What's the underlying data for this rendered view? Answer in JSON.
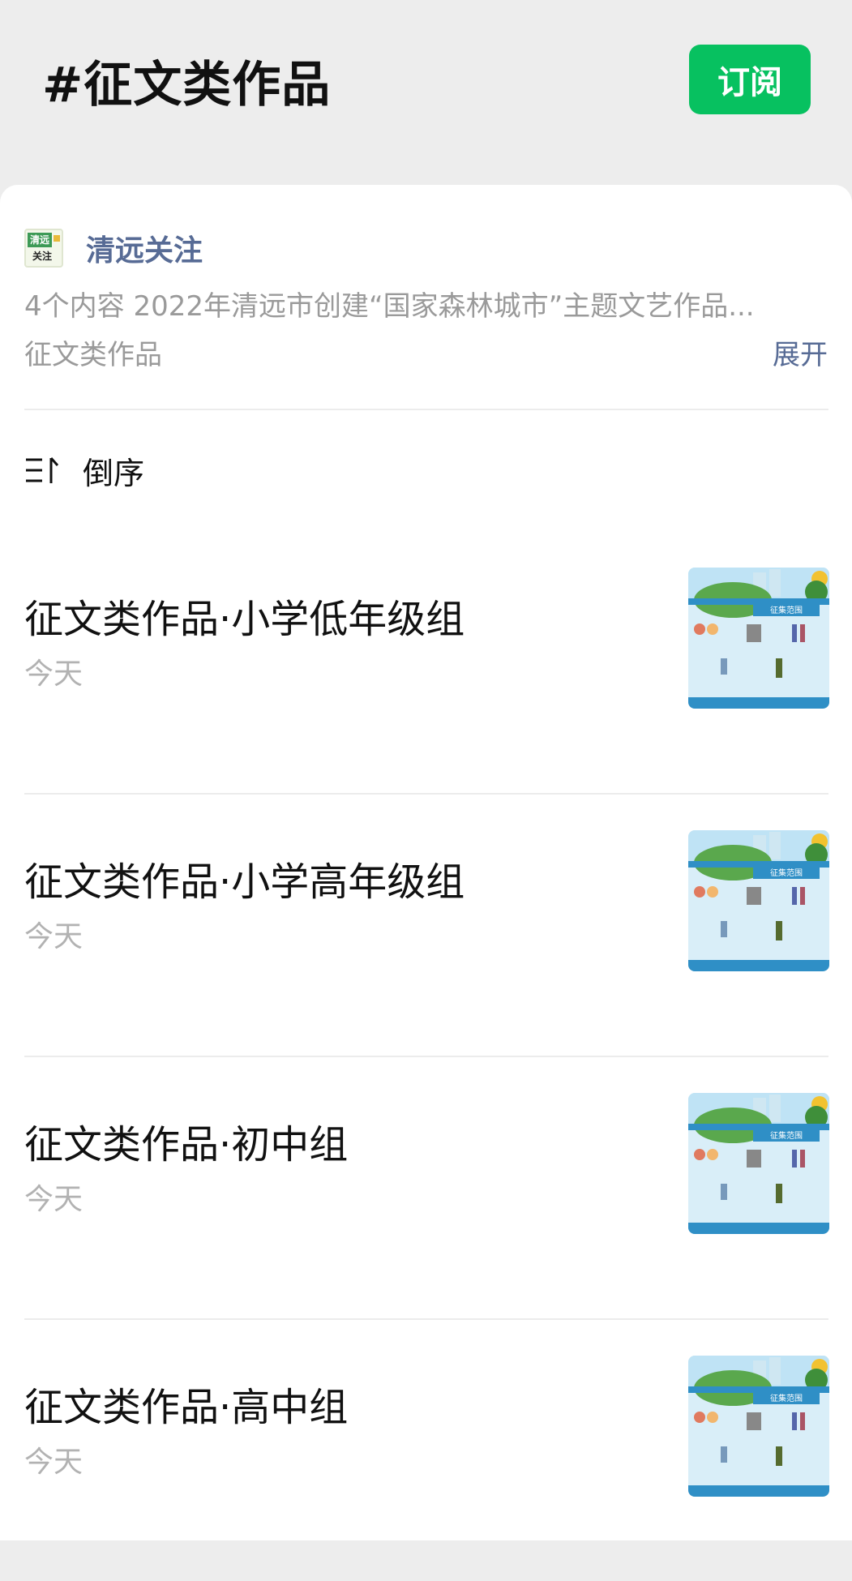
{
  "header": {
    "title": "#征文类作品",
    "subscribe_label": "订阅"
  },
  "account": {
    "logo_text_top": "清远",
    "logo_text_bottom": "关注",
    "name": "清远关注"
  },
  "description": {
    "line1": "4个内容  2022年清远市创建“国家森林城市”主题文艺作品...",
    "line2": "征文类作品",
    "expand_label": "展开"
  },
  "sort": {
    "icon": "sort-order-icon",
    "label": "倒序"
  },
  "items": [
    {
      "title": "征文类作品·小学低年级组",
      "date": "今天",
      "thumb_caption": "征集范围"
    },
    {
      "title": "征文类作品·小学高年级组",
      "date": "今天",
      "thumb_caption": "征集范围"
    },
    {
      "title": "征文类作品·初中组",
      "date": "今天",
      "thumb_caption": "征集范围"
    },
    {
      "title": "征文类作品·高中组",
      "date": "今天",
      "thumb_caption": "征集范围"
    }
  ],
  "colors": {
    "accent": "#07c160",
    "link": "#576b95",
    "muted": "#9a9a9a",
    "background": "#ededed"
  }
}
